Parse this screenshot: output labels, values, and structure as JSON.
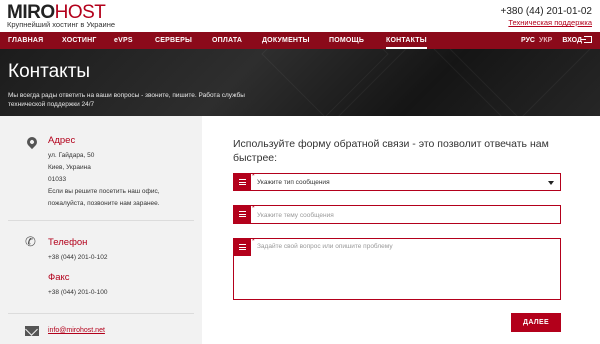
{
  "header": {
    "logo_part1": "MIRO",
    "logo_part2": "HOST",
    "tagline": "Крупнейший хостинг в Украине",
    "phone": "+380 (44) 201-01-02",
    "support_link": "Техническая поддержка"
  },
  "nav": {
    "items": [
      {
        "label": "ГЛАВНАЯ"
      },
      {
        "label": "ХОСТИНГ"
      },
      {
        "label": "eVPS"
      },
      {
        "label": "СЕРВЕРЫ"
      },
      {
        "label": "ОПЛАТА"
      },
      {
        "label": "ДОКУМЕНТЫ"
      },
      {
        "label": "ПОМОЩЬ"
      },
      {
        "label": "КОНТАКТЫ"
      }
    ],
    "active": "КОНТАКТЫ",
    "lang_ru": "РУС",
    "lang_uk": "УКР",
    "login": "ВХОД"
  },
  "hero": {
    "title": "Контакты",
    "subtitle": "Мы всегда рады ответить на ваши вопросы - звоните, пишите. Работа службы технической поддержки 24/7"
  },
  "contacts": {
    "address_title": "Адрес",
    "address_lines": [
      "ул. Гайдара, 50",
      "Киев, Украина",
      "01033"
    ],
    "address_note": "Если вы решите посетить наш офис, пожалуйста, позвоните нам заранее.",
    "phone_title": "Телефон",
    "phone_value": "+38 (044) 201-0-102",
    "fax_title": "Факс",
    "fax_value": "+38 (044) 201-0-100",
    "email": "info@mirohost.net"
  },
  "form": {
    "title": "Используйте форму обратной связи - это позволит отвечать нам быстрее:",
    "type_value": "Укажите тип сообщения",
    "subject_placeholder": "Укажите тему сообщения",
    "message_placeholder": "Задайте свой вопрос или опишите проблему",
    "required_mark": "*",
    "submit_label": "ДАЛЕЕ"
  },
  "colors": {
    "brand": "#b3001b",
    "nav": "#8b0a1a",
    "hero": "#1c1c1c"
  }
}
